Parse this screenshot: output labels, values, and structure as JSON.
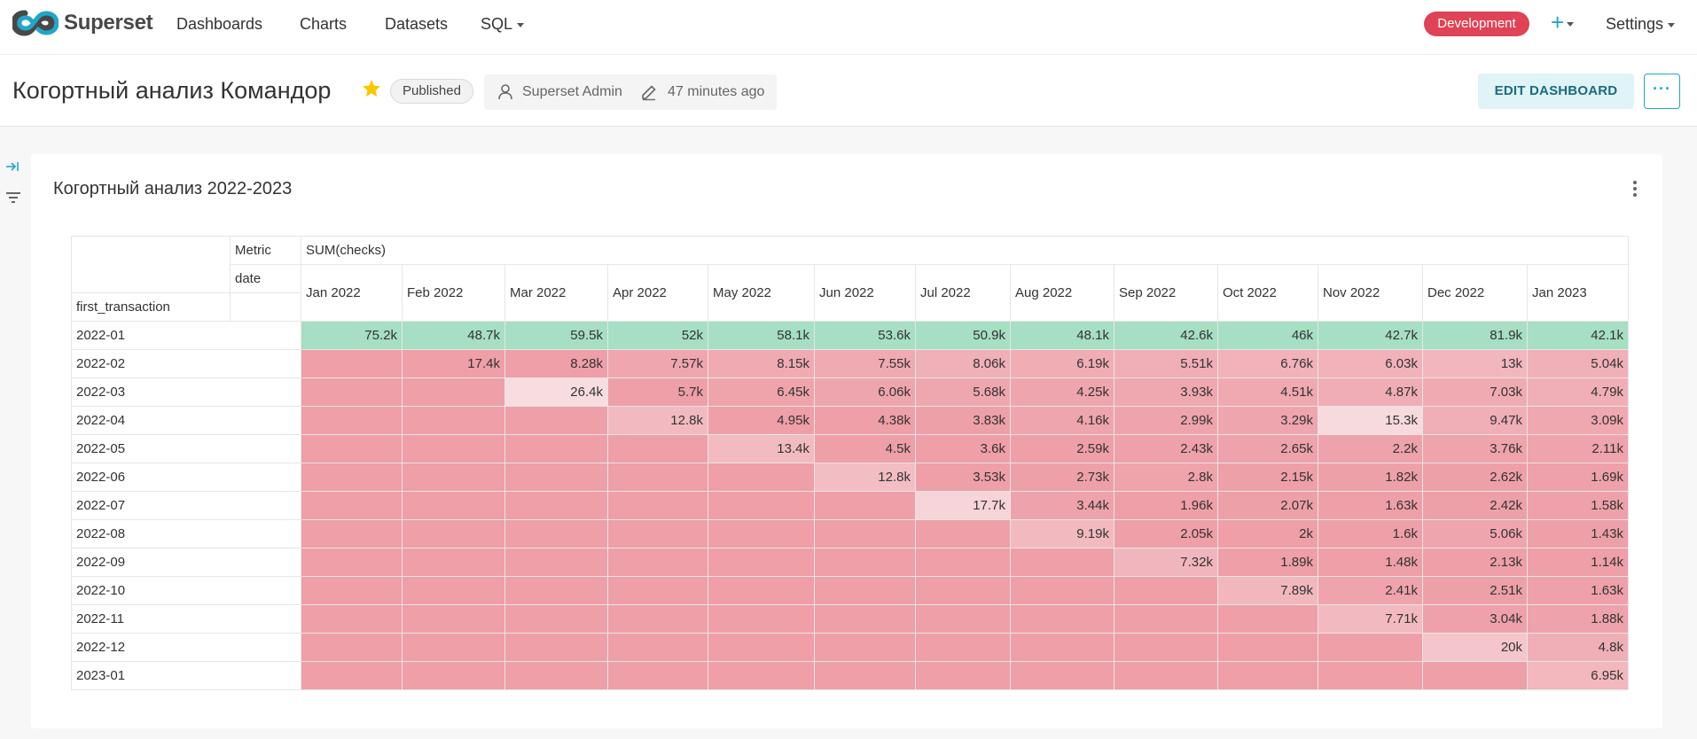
{
  "nav": {
    "brand": "Superset",
    "items": [
      "Dashboards",
      "Charts",
      "Datasets",
      "SQL"
    ],
    "environment": "Development",
    "settings": "Settings"
  },
  "header": {
    "title": "Когортный анализ Командор",
    "status": "Published",
    "owner": "Superset Admin",
    "modified": "47 minutes ago",
    "edit_label": "EDIT DASHBOARD",
    "more_label": "···"
  },
  "chart": {
    "title": "Когортный анализ 2022-2023",
    "metric_label": "Metric",
    "metric": "SUM(checks)",
    "col_label": "date",
    "row_label": "first_transaction",
    "columns": [
      "Jan 2022",
      "Feb 2022",
      "Mar 2022",
      "Apr 2022",
      "May 2022",
      "Jun 2022",
      "Jul 2022",
      "Aug 2022",
      "Sep 2022",
      "Oct 2022",
      "Nov 2022",
      "Dec 2022",
      "Jan 2023"
    ],
    "rows": [
      {
        "label": "2022-01",
        "values": [
          "75.2k",
          "48.7k",
          "59.5k",
          "52k",
          "58.1k",
          "53.6k",
          "50.9k",
          "48.1k",
          "42.6k",
          "46k",
          "42.7k",
          "81.9k",
          "42.1k"
        ]
      },
      {
        "label": "2022-02",
        "values": [
          "",
          "17.4k",
          "8.28k",
          "7.57k",
          "8.15k",
          "7.55k",
          "8.06k",
          "6.19k",
          "5.51k",
          "6.76k",
          "6.03k",
          "13k",
          "5.04k"
        ]
      },
      {
        "label": "2022-03",
        "values": [
          "",
          "",
          "26.4k",
          "5.7k",
          "6.45k",
          "6.06k",
          "5.68k",
          "4.25k",
          "3.93k",
          "4.51k",
          "4.87k",
          "7.03k",
          "4.79k"
        ]
      },
      {
        "label": "2022-04",
        "values": [
          "",
          "",
          "",
          "12.8k",
          "4.95k",
          "4.38k",
          "3.83k",
          "4.16k",
          "2.99k",
          "3.29k",
          "15.3k",
          "9.47k",
          "3.09k"
        ]
      },
      {
        "label": "2022-05",
        "values": [
          "",
          "",
          "",
          "",
          "13.4k",
          "4.5k",
          "3.6k",
          "2.59k",
          "2.43k",
          "2.65k",
          "2.2k",
          "3.76k",
          "2.11k"
        ]
      },
      {
        "label": "2022-06",
        "values": [
          "",
          "",
          "",
          "",
          "",
          "12.8k",
          "3.53k",
          "2.73k",
          "2.8k",
          "2.15k",
          "1.82k",
          "2.62k",
          "1.69k"
        ]
      },
      {
        "label": "2022-07",
        "values": [
          "",
          "",
          "",
          "",
          "",
          "",
          "17.7k",
          "3.44k",
          "1.96k",
          "2.07k",
          "1.63k",
          "2.42k",
          "1.58k"
        ]
      },
      {
        "label": "2022-08",
        "values": [
          "",
          "",
          "",
          "",
          "",
          "",
          "",
          "9.19k",
          "2.05k",
          "2k",
          "1.6k",
          "5.06k",
          "1.43k"
        ]
      },
      {
        "label": "2022-09",
        "values": [
          "",
          "",
          "",
          "",
          "",
          "",
          "",
          "",
          "7.32k",
          "1.89k",
          "1.48k",
          "2.13k",
          "1.14k"
        ]
      },
      {
        "label": "2022-10",
        "values": [
          "",
          "",
          "",
          "",
          "",
          "",
          "",
          "",
          "",
          "7.89k",
          "2.41k",
          "2.51k",
          "1.63k"
        ]
      },
      {
        "label": "2022-11",
        "values": [
          "",
          "",
          "",
          "",
          "",
          "",
          "",
          "",
          "",
          "",
          "7.71k",
          "3.04k",
          "1.88k"
        ]
      },
      {
        "label": "2022-12",
        "values": [
          "",
          "",
          "",
          "",
          "",
          "",
          "",
          "",
          "",
          "",
          "",
          "20k",
          "4.8k"
        ]
      },
      {
        "label": "2023-01",
        "values": [
          "",
          "",
          "",
          "",
          "",
          "",
          "",
          "",
          "",
          "",
          "",
          "",
          "6.95k"
        ]
      }
    ],
    "colors": {
      "low": "#ee9fa8",
      "mid": "#fbf7f7",
      "high": "#a6dfc3"
    }
  }
}
